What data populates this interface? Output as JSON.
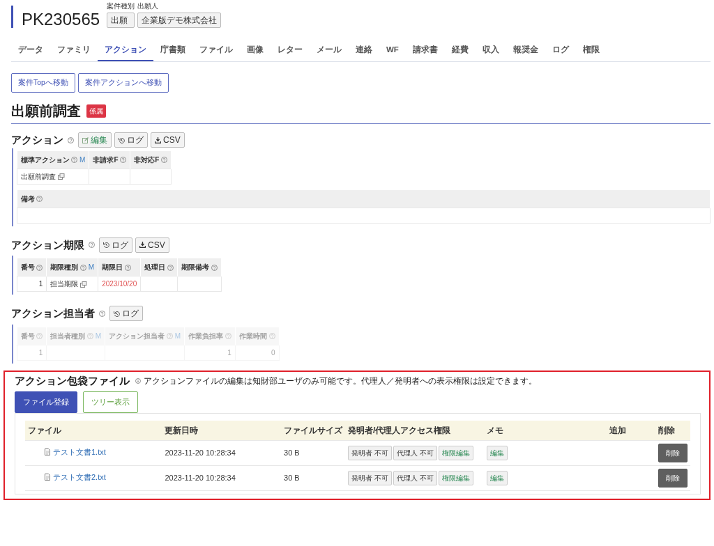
{
  "header": {
    "case_no": "PK230565",
    "fields": [
      {
        "label": "案件種別",
        "value": "出願"
      },
      {
        "label": "出願人",
        "value": "企業版デモ株式会社"
      }
    ]
  },
  "tabs": [
    {
      "label": "データ",
      "selected": false
    },
    {
      "label": "ファミリ",
      "selected": false
    },
    {
      "label": "アクション",
      "selected": true
    },
    {
      "label": "庁書類",
      "selected": false
    },
    {
      "label": "ファイル",
      "selected": false
    },
    {
      "label": "画像",
      "selected": false
    },
    {
      "label": "レター",
      "selected": false
    },
    {
      "label": "メール",
      "selected": false
    },
    {
      "label": "連絡",
      "selected": false
    },
    {
      "label": "WF",
      "selected": false
    },
    {
      "label": "請求書",
      "selected": false
    },
    {
      "label": "経費",
      "selected": false
    },
    {
      "label": "収入",
      "selected": false
    },
    {
      "label": "報奨金",
      "selected": false
    },
    {
      "label": "ログ",
      "selected": false
    },
    {
      "label": "権限",
      "selected": false
    }
  ],
  "nav_buttons": [
    "案件Topへ移動",
    "案件アクションへ移動"
  ],
  "section": {
    "title": "出願前調査",
    "badge": "係属"
  },
  "action": {
    "title": "アクション",
    "buttons": [
      {
        "kind": "edit",
        "label": "編集"
      },
      {
        "kind": "log",
        "label": "ログ"
      },
      {
        "kind": "csv",
        "label": "CSV"
      }
    ],
    "columns": [
      {
        "label": "標準アクション",
        "suffix": "M"
      },
      {
        "label": "非請求F"
      },
      {
        "label": "非対応F"
      }
    ],
    "rows": [
      [
        {
          "text": "出願前調査",
          "copy": true
        },
        {
          "text": ""
        },
        {
          "text": ""
        }
      ]
    ],
    "remarks": {
      "label": "備考"
    }
  },
  "deadlines": {
    "title": "アクション期限",
    "disabled": false,
    "buttons": [
      {
        "kind": "log",
        "label": "ログ"
      },
      {
        "kind": "csv",
        "label": "CSV"
      }
    ],
    "columns": [
      {
        "label": "番号"
      },
      {
        "label": "期限種別",
        "suffix": "M"
      },
      {
        "label": "期限日"
      },
      {
        "label": "処理日"
      },
      {
        "label": "期限備考"
      }
    ],
    "rows": [
      [
        {
          "text": "1"
        },
        {
          "text": "担当期限",
          "copy": true
        },
        {
          "text": "2023/10/20",
          "overdue": true
        },
        {
          "text": ""
        },
        {
          "text": ""
        }
      ]
    ]
  },
  "assignees": {
    "title": "アクション担当者",
    "disabled": true,
    "buttons": [
      {
        "kind": "log",
        "label": "ログ"
      }
    ],
    "columns": [
      {
        "label": "番号"
      },
      {
        "label": "担当者種別",
        "suffix": "M"
      },
      {
        "label": "アクション担当者",
        "suffix": "M"
      },
      {
        "label": "作業負担率"
      },
      {
        "label": "作業時間"
      }
    ],
    "rows": [
      [
        {
          "text": "1"
        },
        {
          "text": ""
        },
        {
          "text": ""
        },
        {
          "text": "1"
        },
        {
          "text": "0"
        }
      ]
    ]
  },
  "files": {
    "title": "アクション包袋ファイル",
    "note": "アクションファイルの編集は知財部ユーザのみ可能です。代理人／発明者への表示権限は設定できます。",
    "highlighted": true,
    "buttons": [
      {
        "kind": "primary",
        "label": "ファイル登録"
      },
      {
        "kind": "outline",
        "label": "ツリー表示"
      }
    ],
    "columns": [
      "ファイル",
      "更新日時",
      "ファイルサイズ",
      "発明者/代理人アクセス権限",
      "メモ",
      "追加",
      "削除"
    ],
    "rows": [
      {
        "name": "テスト文書1.txt",
        "updated": "2023-11-20 10:28:34",
        "size": "30 B",
        "access": [
          "発明者 不可",
          "代理人 不可"
        ],
        "perm_edit": "権限編集",
        "memo_edit": "編集",
        "delete": "削除"
      },
      {
        "name": "テスト文書2.txt",
        "updated": "2023-11-20 10:28:34",
        "size": "30 B",
        "access": [
          "発明者 不可",
          "代理人 不可"
        ],
        "perm_edit": "権限編集",
        "memo_edit": "編集",
        "delete": "削除"
      }
    ]
  }
}
